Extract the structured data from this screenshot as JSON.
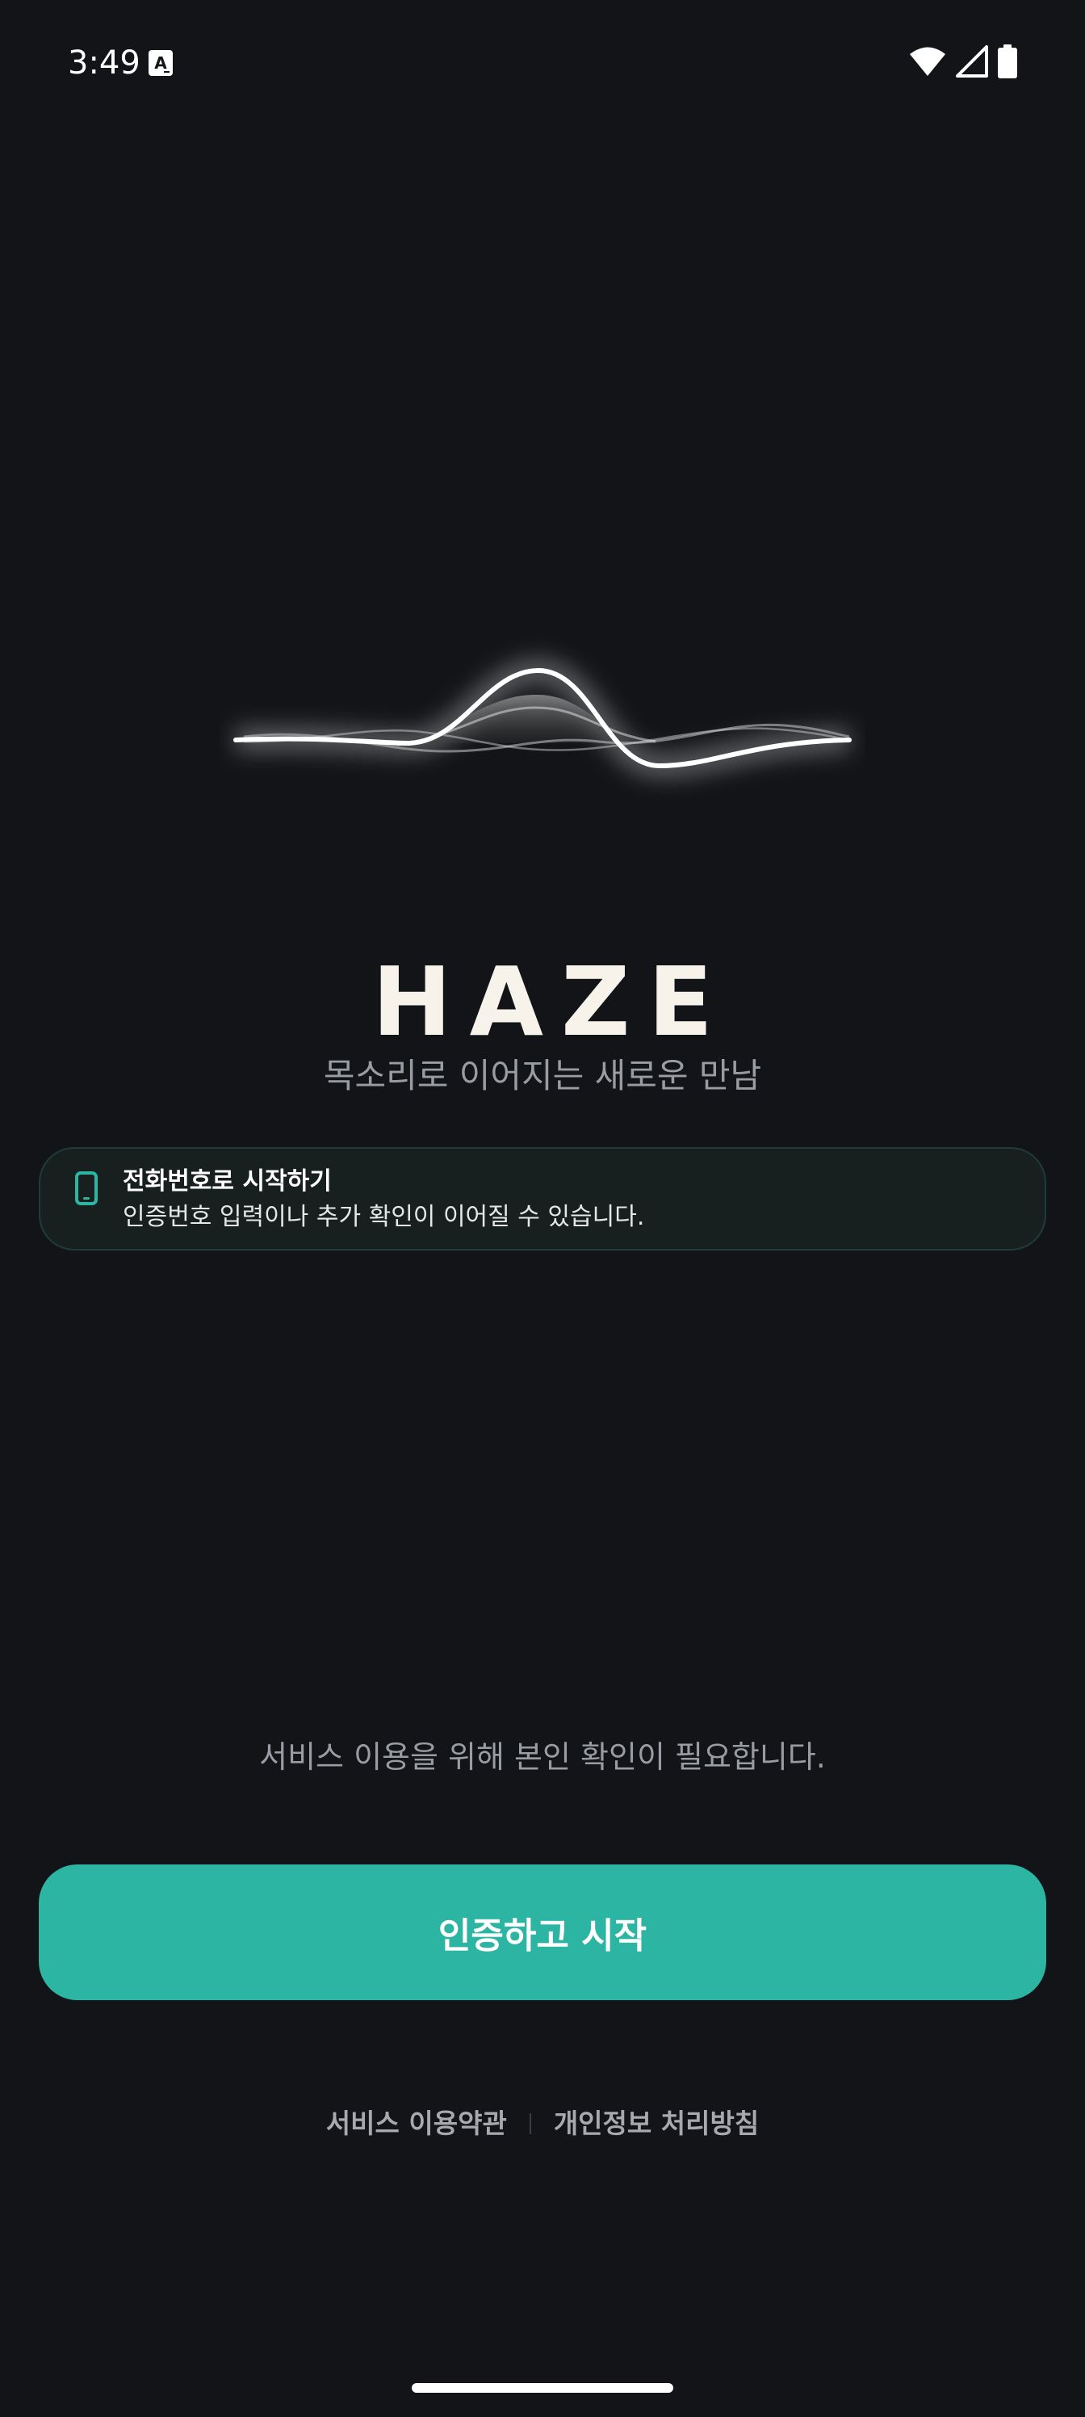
{
  "status_bar": {
    "time": "3:49",
    "app_icon": "text-a-icon",
    "icons": [
      "wifi-icon",
      "signal-icon",
      "battery-icon"
    ]
  },
  "brand": {
    "title": "HAZE",
    "subtitle": "목소리로 이어지는 새로운 만남",
    "logo": "waveform-icon"
  },
  "phone_card": {
    "icon": "smartphone-icon",
    "title": "전화번호로 시작하기",
    "description": "인증번호 입력이나 추가 확인이 이어질 수 있습니다."
  },
  "notice": "서비스 이용을 위해 본인 확인이 필요합니다.",
  "primary_button": {
    "label": "인증하고 시작"
  },
  "footer": {
    "terms_label": "서비스 이용약관",
    "privacy_label": "개인정보 처리방침"
  },
  "colors": {
    "background": "#121418",
    "accent": "#2db5a3",
    "card_border": "#1f3b3a",
    "title": "#f7f3ea",
    "muted_text": "#9a9ca3"
  }
}
